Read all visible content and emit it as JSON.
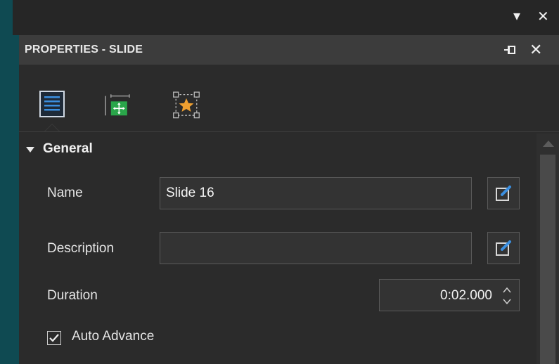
{
  "window": {
    "dropdown_icon": "chevron-down-icon",
    "close_icon": "close-icon"
  },
  "panel": {
    "title": "PROPERTIES - SLIDE",
    "pin_icon": "pin-icon",
    "close_icon": "close-icon",
    "tabs": [
      {
        "name": "general",
        "icon": "list-icon",
        "selected": true
      },
      {
        "name": "layout",
        "icon": "move-icon",
        "selected": false
      },
      {
        "name": "animation",
        "icon": "star-icon",
        "selected": false
      }
    ]
  },
  "general": {
    "section_title": "General",
    "name_label": "Name",
    "name_value": "Slide 16",
    "description_label": "Description",
    "description_value": "",
    "duration_label": "Duration",
    "duration_value": "0:02.000",
    "auto_advance_label": "Auto Advance",
    "auto_advance_checked": true
  },
  "colors": {
    "background": "#0f4a52",
    "panel": "#2b2b2b",
    "accent_green": "#2aa64a",
    "accent_star": "#f0a030",
    "edit_blue": "#3b8fe0"
  }
}
